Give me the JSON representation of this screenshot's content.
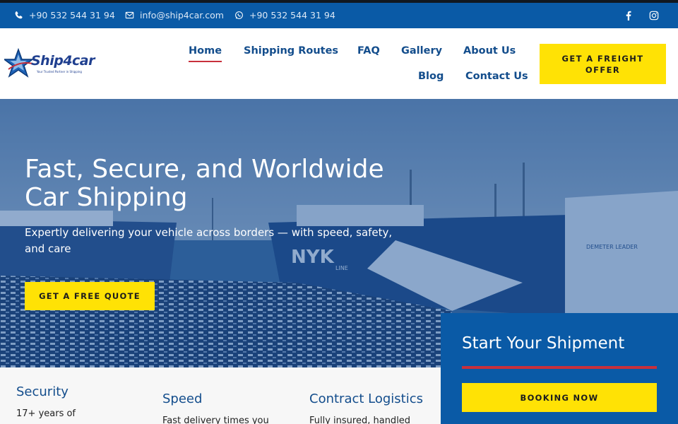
{
  "topbar": {
    "phone": "+90 532 544 31 94",
    "email": "info@ship4car.com",
    "whatsapp": "+90 532 544 31 94",
    "icons": [
      "phone-icon",
      "mail-icon",
      "whatsapp-icon",
      "facebook-icon",
      "instagram-icon"
    ]
  },
  "brand": {
    "name": "Ship4car",
    "tagline": "Your Trusted Partner in Shipping"
  },
  "nav": {
    "items": [
      {
        "label": "Home",
        "active": true
      },
      {
        "label": "Shipping Routes",
        "active": false
      },
      {
        "label": "FAQ",
        "active": false
      },
      {
        "label": "Gallery",
        "active": false
      },
      {
        "label": "About Us",
        "active": false
      },
      {
        "label": "Blog",
        "active": false
      },
      {
        "label": "Contact Us",
        "active": false
      }
    ],
    "cta_label": "GET A FREIGHT OFFER"
  },
  "hero": {
    "title": "Fast, Secure, and Worldwide Car Shipping",
    "subtitle": "Expertly delivering your vehicle across borders — with speed, safety, and care",
    "button_label": "GET A FREE QUOTE"
  },
  "features": [
    {
      "title": "Security",
      "text": "17+ years of"
    },
    {
      "title": "Speed",
      "text": "Fast delivery times you"
    },
    {
      "title": "Contract Logistics",
      "text": "Fully insured, handled"
    }
  ],
  "shipment": {
    "title": "Start Your Shipment",
    "button_label": "BOOKING NOW"
  },
  "colors": {
    "primary_blue": "#0a5aa6",
    "nav_blue": "#134d8c",
    "accent_yellow": "#ffe205",
    "accent_red": "#c8303c"
  }
}
